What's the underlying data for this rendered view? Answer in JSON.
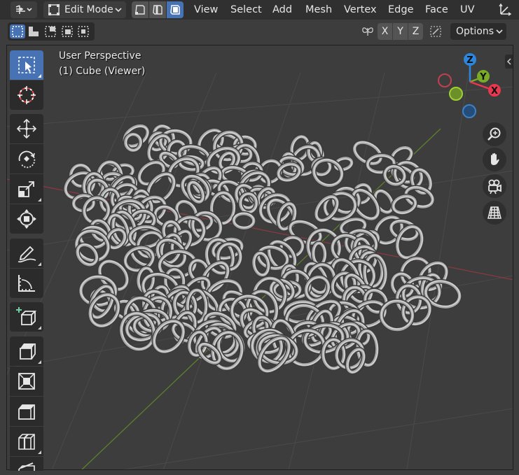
{
  "header": {
    "mode_label": "Edit Mode",
    "menus": [
      "View",
      "Select",
      "Add",
      "Mesh",
      "Vertex",
      "Edge",
      "Face",
      "UV"
    ]
  },
  "subbar": {
    "axis_x": "X",
    "axis_y": "Y",
    "axis_z": "Z",
    "options_label": "Options"
  },
  "viewport": {
    "perspective_label": "User Perspective",
    "object_label": "(1) Cube (Viewer)"
  },
  "gizmo": {
    "z_label": "Z",
    "y_label": "Y",
    "x_label": "X"
  },
  "colors": {
    "accent": "#4772b3",
    "axis_x": "#e8374e",
    "axis_y": "#7aab26",
    "axis_z": "#2d86de"
  },
  "toolbar_tools": [
    "select-box",
    "cursor",
    "move",
    "rotate",
    "scale",
    "transform",
    "annotate",
    "measure",
    "add-cube",
    "extrude",
    "inset",
    "bevel",
    "loop-cut",
    "knife"
  ]
}
